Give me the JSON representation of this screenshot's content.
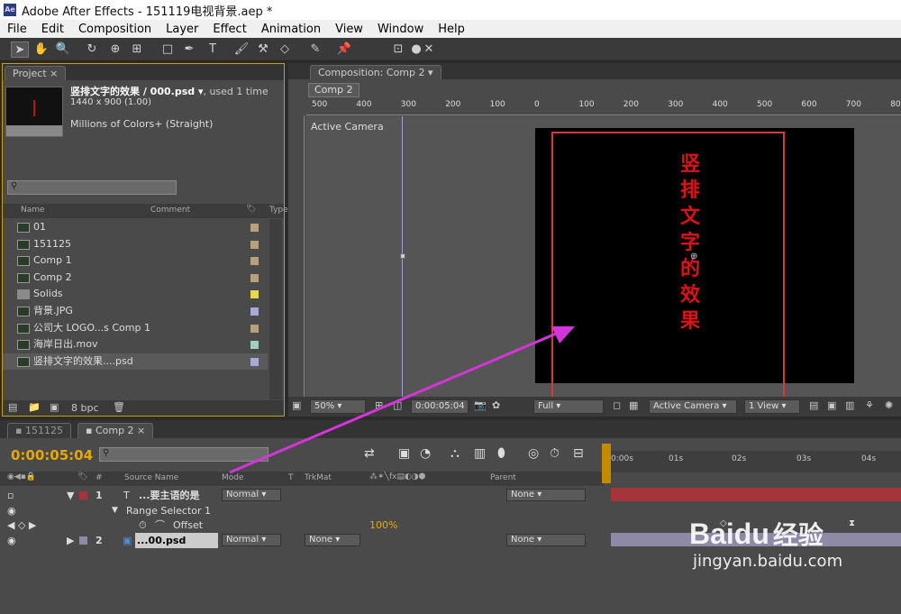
{
  "window": {
    "title": "Adobe After Effects - 151119电视背景.aep *",
    "logo": "Ae"
  },
  "menu": [
    "File",
    "Edit",
    "Composition",
    "Layer",
    "Effect",
    "Animation",
    "View",
    "Window",
    "Help"
  ],
  "project": {
    "tab": "Project",
    "selected_name": "竖排文字的效果 / 000.psd ▾",
    "used": ", used 1 time",
    "dimensions": "1440 x 900 (1.00)",
    "colors": "Millions of Colors+ (Straight)",
    "col_name": "Name",
    "col_comment": "Comment",
    "col_type": "Type",
    "items": [
      {
        "name": "01",
        "color": "#b7a07c"
      },
      {
        "name": "151125",
        "color": "#b7a07c"
      },
      {
        "name": "Comp 1",
        "color": "#b7a07c"
      },
      {
        "name": "Comp 2",
        "color": "#b7a07c"
      },
      {
        "name": "Solids",
        "color": "#e4d84c"
      },
      {
        "name": "背景.JPG",
        "color": "#a9a9d8"
      },
      {
        "name": "公司大 LOGO...s Comp 1",
        "color": "#b7a07c"
      },
      {
        "name": "海岸日出.mov",
        "color": "#9fcfc0"
      },
      {
        "name": "竖排文字的效果....psd",
        "color": "#a9a9d8"
      }
    ],
    "bpc": "8 bpc"
  },
  "composition": {
    "tab": "Composition: Comp 2",
    "subtab": "Comp 2",
    "camera_label": "Active Camera",
    "ruler_labels": [
      "500",
      "400",
      "300",
      "200",
      "100",
      "0",
      "100",
      "200",
      "300",
      "400",
      "500",
      "600",
      "700",
      "800"
    ],
    "vertical_text": [
      "竖",
      "排",
      "文",
      "字",
      "的",
      "效",
      "果"
    ],
    "zoom": "50%",
    "time": "0:00:05:04",
    "resolution": "Full",
    "view": "Active Camera",
    "views": "1 View"
  },
  "timeline": {
    "tabs": [
      "151125",
      "Comp 2"
    ],
    "timecode": "0:00:05:04",
    "col_source": "Source Name",
    "col_mode": "Mode",
    "col_t": "T",
    "col_trkmat": "TrkMat",
    "col_parent": "Parent",
    "col_num": "#",
    "ruler_ticks": [
      "0:00s",
      "01s",
      "02s",
      "03s",
      "04s"
    ],
    "layers": [
      {
        "num": "1",
        "name": "...要主语的是",
        "mode": "Normal",
        "trkmat": "",
        "parent": "None",
        "color": "#a5353a"
      },
      {
        "num": "2",
        "name": "...00.psd",
        "mode": "Normal",
        "trkmat": "None",
        "parent": "None",
        "color": "#8e8aa6"
      }
    ],
    "range_selector": "Range Selector 1",
    "offset_label": "Offset",
    "offset_value": "100%"
  },
  "watermark": {
    "brand": "Baidu",
    "brand_cn": "经验",
    "url": "jingyan.baidu.com"
  }
}
